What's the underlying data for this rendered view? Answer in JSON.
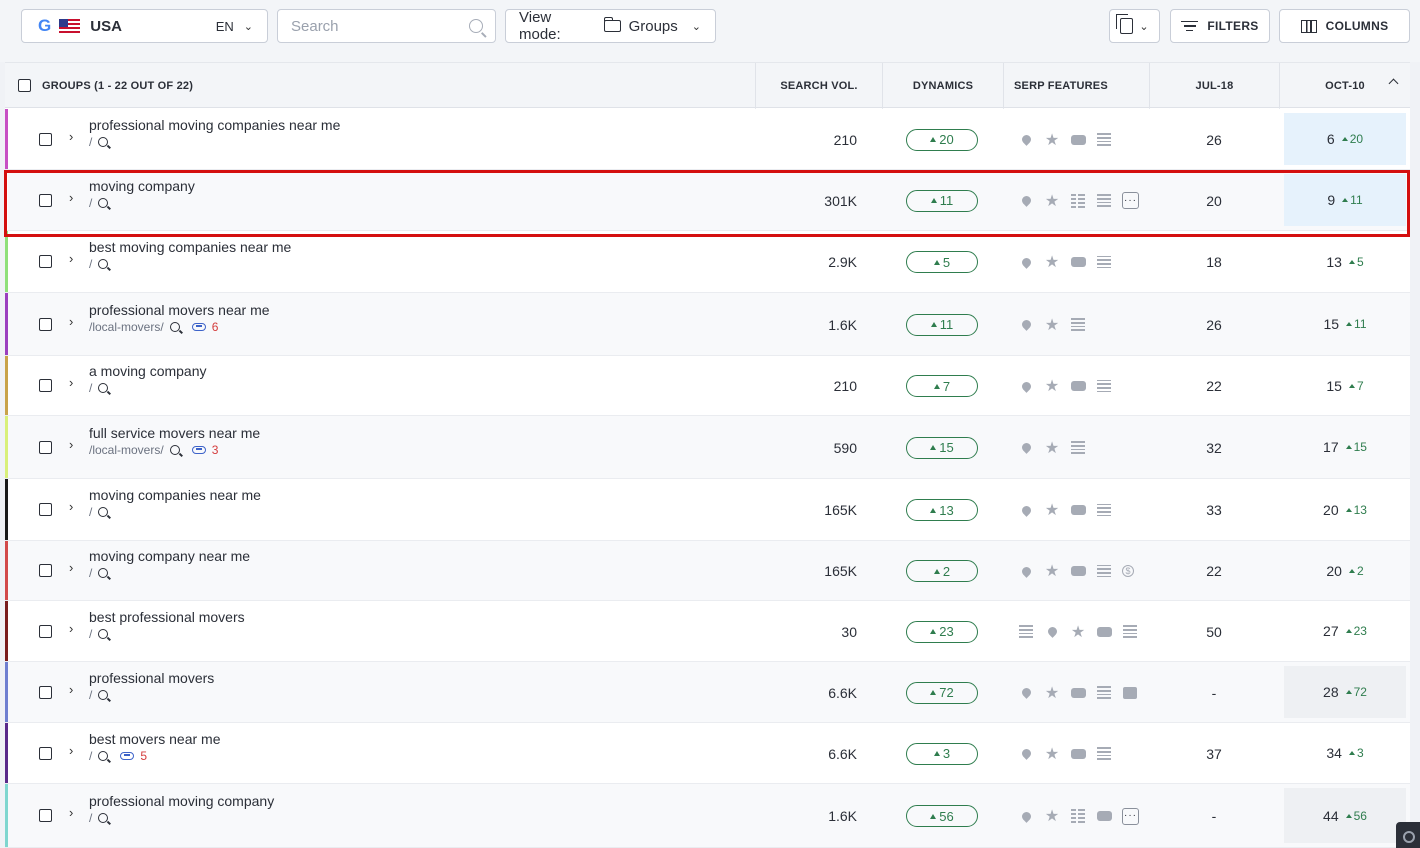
{
  "toolbar": {
    "engine_icon": "google-icon",
    "engine_letter": "G",
    "country": "USA",
    "language": "EN",
    "search_placeholder": "Search",
    "view_mode_label": "View mode:",
    "view_mode_value": "Groups",
    "filters_label": "FILTERS",
    "columns_label": "COLUMNS"
  },
  "table": {
    "headers": {
      "groups": "GROUPS (1 - 22 OUT OF 22)",
      "search_vol": "SEARCH VOL.",
      "dynamics": "DYNAMICS",
      "serp": "SERP FEATURES",
      "jul": "JUL-18",
      "oct": "OCT-10"
    },
    "rows": [
      {
        "keyword": "professional moving companies near me",
        "path": "/",
        "links": "",
        "volume": "210",
        "dynamics": "20",
        "jul": "26",
        "oct_pos": "6",
        "oct_change": "20",
        "serp": [
          "pin",
          "star",
          "video",
          "lines"
        ],
        "stripe": "#c750c4"
      },
      {
        "keyword": "moving company",
        "path": "/",
        "links": "",
        "volume": "301K",
        "dynamics": "11",
        "jul": "20",
        "oct_pos": "9",
        "oct_change": "11",
        "serp": [
          "pin",
          "star",
          "table",
          "lines",
          "more"
        ],
        "stripe": "#ffffff"
      },
      {
        "keyword": "best moving companies near me",
        "path": "/",
        "links": "",
        "volume": "2.9K",
        "dynamics": "5",
        "jul": "18",
        "oct_pos": "13",
        "oct_change": "5",
        "serp": [
          "pin",
          "star",
          "video",
          "lines"
        ],
        "stripe": "#8fe07a"
      },
      {
        "keyword": "professional movers near me",
        "path": "/local-movers/",
        "links": "6",
        "volume": "1.6K",
        "dynamics": "11",
        "jul": "26",
        "oct_pos": "15",
        "oct_change": "11",
        "serp": [
          "pin",
          "star",
          "lines"
        ],
        "stripe": "#9b3fbf"
      },
      {
        "keyword": "a moving company",
        "path": "/",
        "links": "",
        "volume": "210",
        "dynamics": "7",
        "jul": "22",
        "oct_pos": "15",
        "oct_change": "7",
        "serp": [
          "pin",
          "star",
          "video",
          "lines"
        ],
        "stripe": "#c9a34a"
      },
      {
        "keyword": "full service movers near me",
        "path": "/local-movers/",
        "links": "3",
        "volume": "590",
        "dynamics": "15",
        "jul": "32",
        "oct_pos": "17",
        "oct_change": "15",
        "serp": [
          "pin",
          "star",
          "lines"
        ],
        "stripe": "#d9f07a"
      },
      {
        "keyword": "moving companies near me",
        "path": "/",
        "links": "",
        "volume": "165K",
        "dynamics": "13",
        "jul": "33",
        "oct_pos": "20",
        "oct_change": "13",
        "serp": [
          "pin",
          "star",
          "video",
          "lines"
        ],
        "stripe": "#1a1a1a"
      },
      {
        "keyword": "moving company near me",
        "path": "/",
        "links": "",
        "volume": "165K",
        "dynamics": "2",
        "jul": "22",
        "oct_pos": "20",
        "oct_change": "2",
        "serp": [
          "pin",
          "star",
          "video",
          "lines",
          "money"
        ],
        "stripe": "#d24a4a"
      },
      {
        "keyword": "best professional movers",
        "path": "/",
        "links": "",
        "volume": "30",
        "dynamics": "23",
        "jul": "50",
        "oct_pos": "27",
        "oct_change": "23",
        "serp": [
          "lines",
          "pin",
          "star",
          "video",
          "lines"
        ],
        "stripe": "#7a1e1e"
      },
      {
        "keyword": "professional movers",
        "path": "/",
        "links": "",
        "volume": "6.6K",
        "dynamics": "72",
        "jul": "-",
        "oct_pos": "28",
        "oct_change": "72",
        "serp": [
          "pin",
          "star",
          "video",
          "lines",
          "image"
        ],
        "stripe": "#6f7fd0"
      },
      {
        "keyword": "best movers near me",
        "path": "/",
        "links": "5",
        "volume": "6.6K",
        "dynamics": "3",
        "jul": "37",
        "oct_pos": "34",
        "oct_change": "3",
        "serp": [
          "pin",
          "star",
          "video",
          "lines"
        ],
        "stripe": "#5a2a8a"
      },
      {
        "keyword": "professional moving company",
        "path": "/",
        "links": "",
        "volume": "1.6K",
        "dynamics": "56",
        "jul": "-",
        "oct_pos": "44",
        "oct_change": "56",
        "serp": [
          "pin",
          "star",
          "table",
          "video",
          "more"
        ],
        "stripe": "#7fd6cf"
      }
    ]
  },
  "colors": {
    "accent_green": "#2f7d4e",
    "highlight_red": "#d40f0f",
    "link_blue": "#3d63c9"
  }
}
